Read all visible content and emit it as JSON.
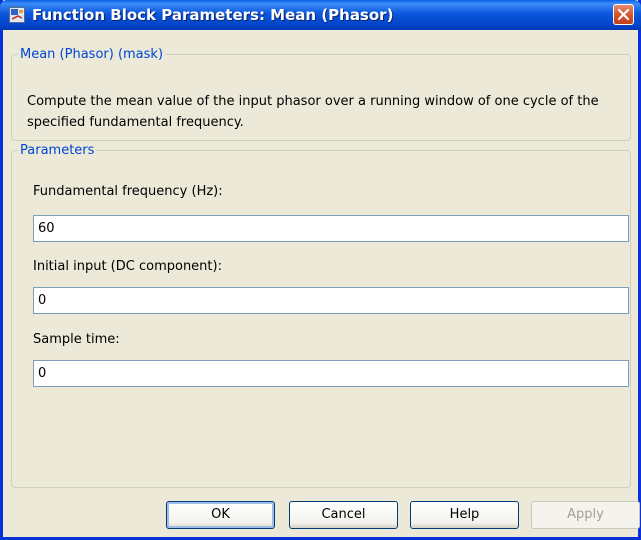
{
  "window": {
    "title": "Function Block Parameters: Mean (Phasor)"
  },
  "mask_group": {
    "legend": "Mean (Phasor) (mask)",
    "description": "Compute the mean value of the input phasor over a running window of one cycle of the specified fundamental frequency."
  },
  "parameters": {
    "legend": "Parameters",
    "fields": [
      {
        "label": "Fundamental frequency (Hz):",
        "value": "60"
      },
      {
        "label": "Initial input (DC component):",
        "value": "0"
      },
      {
        "label": "Sample time:",
        "value": "0"
      }
    ]
  },
  "buttons": {
    "ok": "OK",
    "cancel": "Cancel",
    "help": "Help",
    "apply": "Apply"
  },
  "colors": {
    "title_bar": "#0b57de",
    "group_legend": "#0046d5",
    "close_button": "#d4512c"
  },
  "icons": {
    "app": "simulink-block-icon",
    "close": "close-icon"
  }
}
